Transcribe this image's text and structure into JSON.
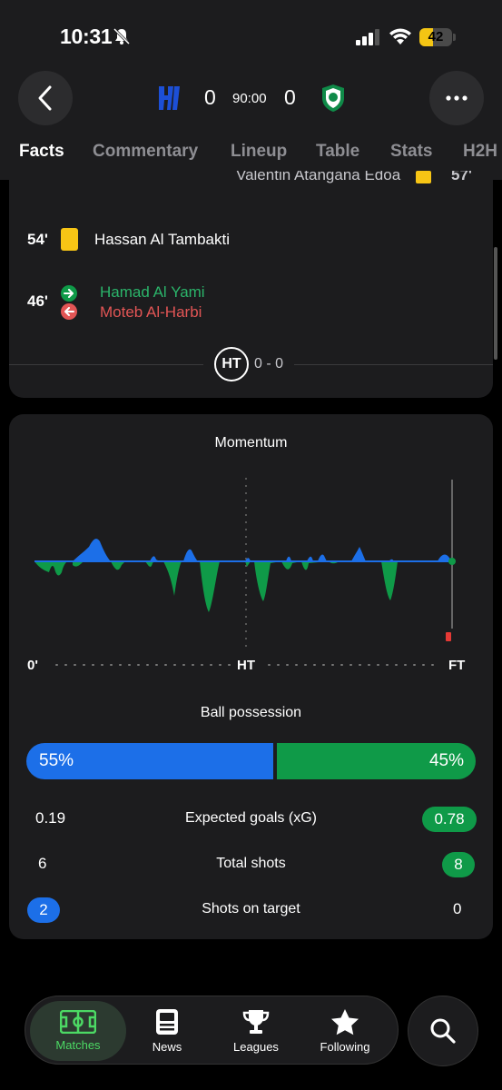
{
  "status_bar": {
    "time": "10:31",
    "battery": "42",
    "battery_level": 0.42
  },
  "match": {
    "home_score": "0",
    "away_score": "0",
    "clock": "90:00",
    "home_color": "#1c6fe8",
    "away_color": "#0f9a48"
  },
  "tabs": [
    "Facts",
    "Commentary",
    "Lineup",
    "Table",
    "Stats",
    "H2H"
  ],
  "events": {
    "partial_above": {
      "player": "Valentin Atangana Edoa",
      "minute": "57'"
    },
    "yellow_card": {
      "minute": "54'",
      "player": "Hassan Al Tambakti"
    },
    "substitution": {
      "minute": "46'",
      "player_in": "Hamad Al Yami",
      "player_out": "Moteb Al-Harbi"
    },
    "halftime": {
      "badge": "HT",
      "score": "0 - 0"
    }
  },
  "momentum": {
    "title": "Momentum",
    "start_label": "0'",
    "half_label": "HT",
    "end_label": "FT"
  },
  "possession": {
    "title": "Ball possession",
    "home": "55%",
    "away": "45%",
    "home_value": 55,
    "away_value": 45
  },
  "stats": [
    {
      "label": "Expected goals (xG)",
      "home": "0.19",
      "away": "0.78",
      "highlight": "away"
    },
    {
      "label": "Total shots",
      "home": "6",
      "away": "8",
      "highlight": "away"
    },
    {
      "label": "Shots on target",
      "home": "2",
      "away": "0",
      "highlight": "home"
    }
  ],
  "nav": {
    "items": [
      "Matches",
      "News",
      "Leagues",
      "Following"
    ],
    "active": "Matches"
  },
  "icons": [
    "back-arrow-icon",
    "more-icon",
    "bell-slash-icon",
    "signal-icon",
    "wifi-icon",
    "battery-icon",
    "pitch-icon",
    "news-icon",
    "trophy-icon",
    "star-icon",
    "search-icon",
    "sub-in-icon",
    "sub-out-icon"
  ]
}
